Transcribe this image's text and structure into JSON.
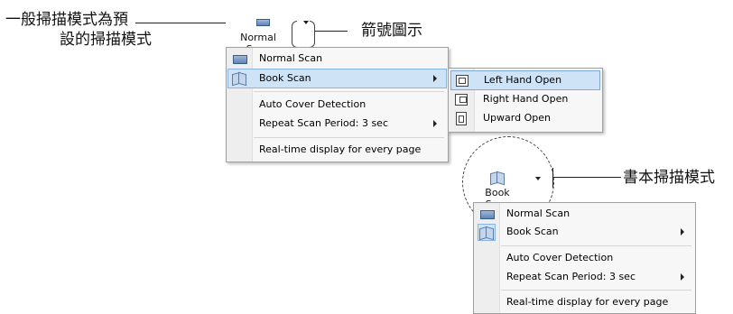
{
  "annotations": {
    "default_mode_line1": "一般掃描模式為預",
    "default_mode_line2": "設的掃描模式",
    "arrow_icon": "箭號圖示",
    "book_mode": "書本掃描模式"
  },
  "top_demo": {
    "button_label": "Normal Scan",
    "menu": [
      {
        "label": "Normal Scan",
        "icon": "scanner-icon"
      },
      {
        "label": "Book Scan",
        "icon": "book-icon",
        "submenu": true
      },
      {
        "label": "Auto Cover Detection"
      },
      {
        "label": "Repeat Scan Period:  3 sec",
        "submenu": true
      },
      {
        "label": "Real-time display for every page"
      }
    ],
    "submenu": [
      {
        "label": "Left Hand Open",
        "icon": "left-hand-open-icon",
        "highlighted": true
      },
      {
        "label": "Right Hand Open",
        "icon": "right-hand-open-icon"
      },
      {
        "label": "Upward Open",
        "icon": "upward-open-icon"
      }
    ]
  },
  "bottom_demo": {
    "button_label": "Book Scan",
    "menu": [
      {
        "label": "Normal Scan",
        "icon": "scanner-icon"
      },
      {
        "label": "Book Scan",
        "icon": "book-icon",
        "submenu": true
      },
      {
        "label": "Auto Cover Detection"
      },
      {
        "label": "Repeat Scan Period:  3 sec",
        "submenu": true
      },
      {
        "label": "Real-time display for every page"
      }
    ]
  },
  "colors": {
    "highlight": "#cfe3f7",
    "highlight_border": "#89b4e3",
    "menu_bg": "#f7f7f7"
  }
}
